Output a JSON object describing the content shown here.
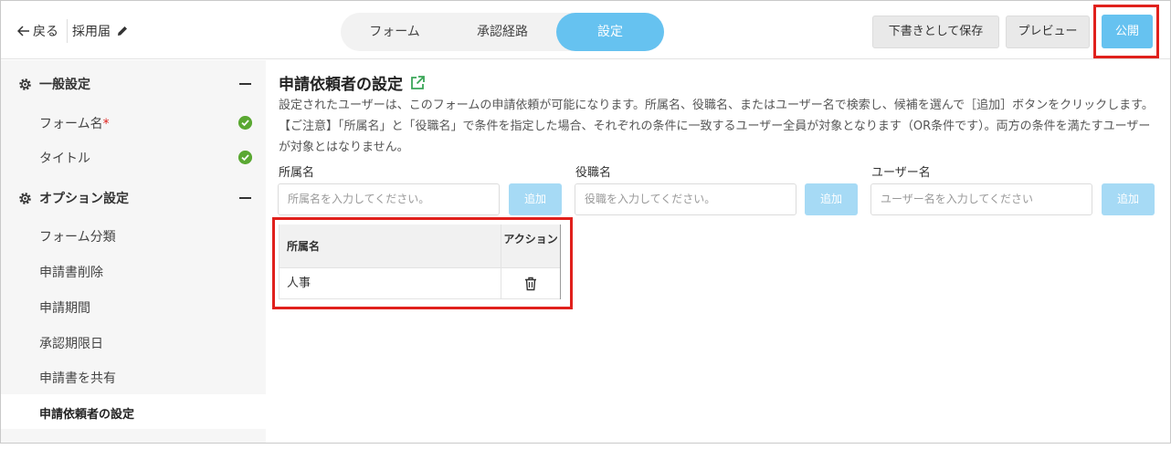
{
  "header": {
    "back_label": "戻る",
    "form_title": "採用届",
    "tabs": [
      {
        "label": "フォーム"
      },
      {
        "label": "承認経路"
      },
      {
        "label": "設定"
      }
    ],
    "active_tab": "設定",
    "save_draft_label": "下書きとして保存",
    "preview_label": "プレビュー",
    "publish_label": "公開",
    "accent_color": "#66c2f0",
    "highlight_color": "#e0201c"
  },
  "sidebar": {
    "sections": [
      {
        "label": "一般設定",
        "items": [
          {
            "label": "フォーム名",
            "required_mark": "*",
            "status": "check"
          },
          {
            "label": "タイトル",
            "status": "check"
          }
        ]
      },
      {
        "label": "オプション設定",
        "items": [
          {
            "label": "フォーム分類"
          },
          {
            "label": "申請書削除"
          },
          {
            "label": "申請期間"
          },
          {
            "label": "承認期限日"
          },
          {
            "label": "申請書を共有"
          },
          {
            "label": "申請依頼者の設定",
            "active": true
          }
        ]
      }
    ]
  },
  "main": {
    "title": "申請依頼者の設定",
    "description": "設定されたユーザーは、このフォームの申請依頼が可能になります。所属名、役職名、またはユーザー名で検索し、候補を選んで［追加］ボタンをクリックします。【ご注意】「所属名」と「役職名」で条件を指定した場合、それぞれの条件に一致するユーザー全員が対象となります（OR条件です）。両方の条件を満たすユーザーが対象とはなりません。",
    "fields": [
      {
        "label": "所属名",
        "placeholder": "所属名を入力してください。",
        "add_label": "追加"
      },
      {
        "label": "役職名",
        "placeholder": "役職を入力してください。",
        "add_label": "追加"
      },
      {
        "label": "ユーザー名",
        "placeholder": "ユーザー名を入力してください",
        "add_label": "追加"
      }
    ],
    "table": {
      "columns": [
        "所属名",
        "アクション"
      ],
      "rows": [
        {
          "name": "人事",
          "action_icon": "trash-icon"
        }
      ]
    }
  }
}
